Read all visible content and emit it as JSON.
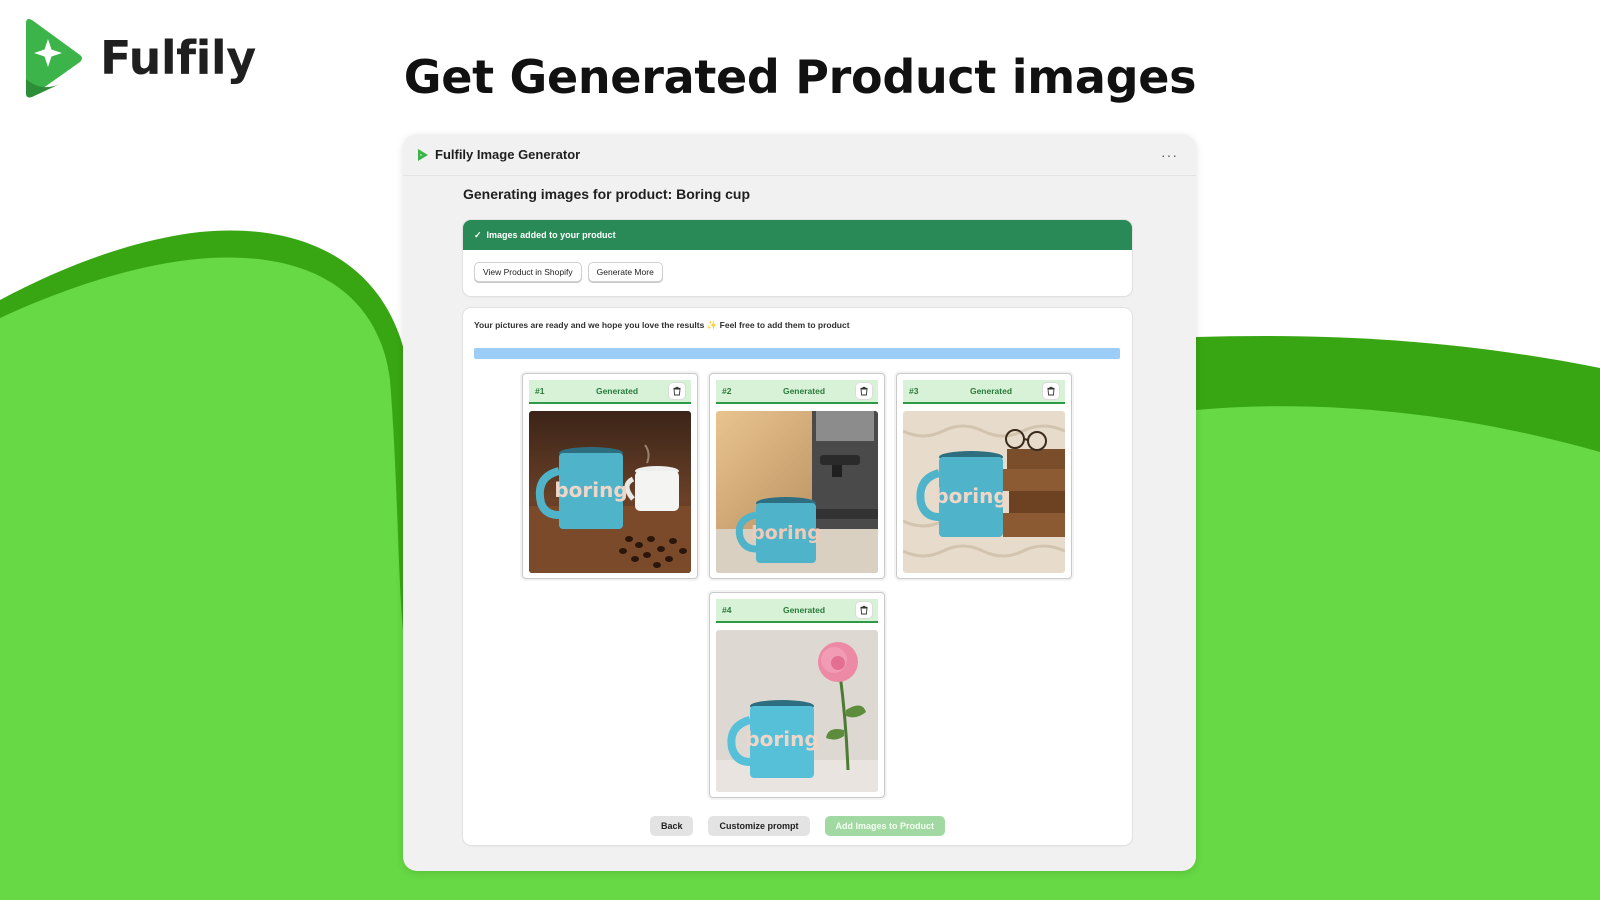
{
  "brand": {
    "name": "Fulfily"
  },
  "headline": "Get Generated Product images",
  "colors": {
    "brand_green": "#3db44a",
    "wave_light": "#66d944",
    "wave_dark": "#38a612",
    "banner_green": "#2a8a57",
    "progress_blue": "#9ccdf6",
    "tile_header_bg": "#d7f2d7"
  },
  "app": {
    "title": "Fulfily Image Generator",
    "more_label": "···",
    "heading": "Generating images for product: Boring cup",
    "banner": {
      "icon": "check-icon",
      "check_glyph": "✓",
      "message": "Images added to your product",
      "actions": [
        "View Product in Shopify",
        "Generate More"
      ]
    },
    "results": {
      "message": "Your pictures are ready and we hope you love the results ✨ Feel free to add them to product",
      "progress": 1.0,
      "images": [
        {
          "number": "#1",
          "status": "Generated",
          "scene": "mug on wooden table with coffee beans",
          "mug_text": "boring"
        },
        {
          "number": "#2",
          "status": "Generated",
          "scene": "mug beside espresso machine",
          "mug_text": "boring"
        },
        {
          "number": "#3",
          "status": "Generated",
          "scene": "mug on knit blanket with books and glasses",
          "mug_text": "boring"
        },
        {
          "number": "#4",
          "status": "Generated",
          "scene": "mug with pink ranunculus flower",
          "mug_text": "boring"
        }
      ]
    },
    "footer": {
      "back": "Back",
      "customize": "Customize prompt",
      "add": "Add Images to Product"
    }
  }
}
